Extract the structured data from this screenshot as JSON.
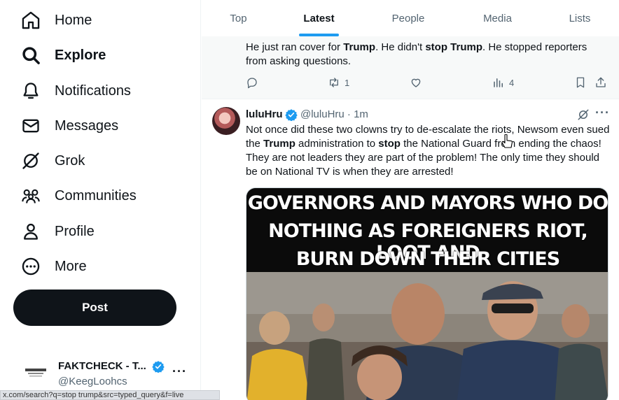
{
  "sidebar": {
    "nav": [
      {
        "label": "Home",
        "icon": "home-icon"
      },
      {
        "label": "Explore",
        "icon": "search-icon",
        "active": true
      },
      {
        "label": "Notifications",
        "icon": "bell-icon"
      },
      {
        "label": "Messages",
        "icon": "envelope-icon"
      },
      {
        "label": "Grok",
        "icon": "grok-icon"
      },
      {
        "label": "Communities",
        "icon": "communities-icon"
      },
      {
        "label": "Profile",
        "icon": "person-icon"
      },
      {
        "label": "More",
        "icon": "more-circle-icon"
      }
    ],
    "post_label": "Post",
    "account": {
      "name": "FAKTCHECK - T...",
      "handle": "@KeegLoohcs",
      "more": "···"
    }
  },
  "status_url": "x.com/search?q=stop trump&src=typed_query&f=live",
  "tabs": [
    {
      "label": "Top"
    },
    {
      "label": "Latest",
      "active": true
    },
    {
      "label": "People"
    },
    {
      "label": "Media"
    },
    {
      "label": "Lists"
    }
  ],
  "tweet1": {
    "text_parts": {
      "a": "He just ran cover for ",
      "b": "Trump",
      "c": ". He didn't ",
      "d": "stop",
      "e": " ",
      "f": "Trump",
      "g": ". He stopped reporters from asking questions."
    },
    "retweets": "1",
    "views": "4"
  },
  "tweet2": {
    "name": "luluHru",
    "handle": "@luluHru · 1m",
    "more": "···",
    "text_parts": {
      "a": "Not once did these two clowns try to de-escalate the riots, Newsom even sued the ",
      "b": "Trump",
      "c": " administration to ",
      "d": "stop",
      "e": " the National Guard from ending the chaos! They are not leaders they are part of the problem! The only time they should be on National TV is when they are arrested!"
    },
    "media_text": [
      "GOVERNORS AND MAYORS WHO DO",
      "NOTHING AS FOREIGNERS RIOT, LOOT AND",
      "BURN DOWN THEIR CITIES"
    ]
  },
  "colors": {
    "accent": "#1d9bf0",
    "text": "#0f1419",
    "muted": "#536471",
    "post_button": "#0f1419"
  }
}
